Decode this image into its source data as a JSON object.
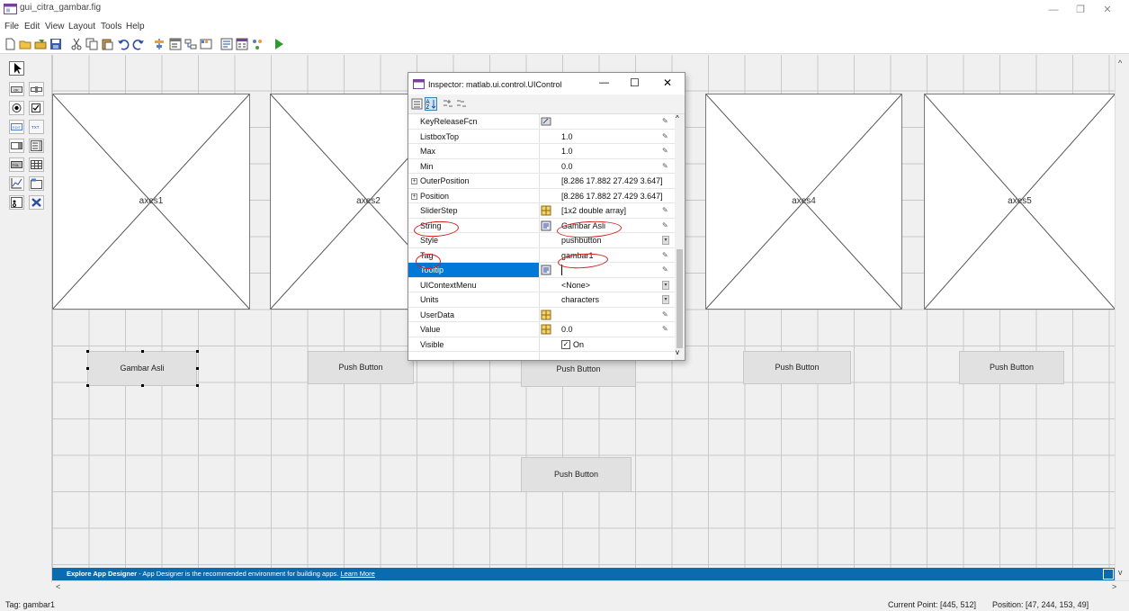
{
  "window": {
    "title": "gui_citra_gambar.fig",
    "minimize": "—",
    "restore": "❐",
    "close": "✕"
  },
  "menu": [
    "File",
    "Edit",
    "View",
    "Layout",
    "Tools",
    "Help"
  ],
  "toolbar_icons": [
    "new-icon",
    "open-icon",
    "open-editor-icon",
    "save-icon",
    "cut-icon",
    "copy-icon",
    "paste-icon",
    "undo-icon",
    "redo-icon",
    "align-icon",
    "menu-editor-icon",
    "tab-order-icon",
    "toolbar-editor-icon",
    "editor-icon",
    "property-inspector-icon",
    "object-browser-icon",
    "run-icon"
  ],
  "palette_icons": [
    "select-tool-icon",
    "pushbutton-tool-icon",
    "slider-tool-icon",
    "radio-tool-icon",
    "checkbox-tool-icon",
    "edit-text-tool-icon",
    "static-text-tool-icon",
    "popup-menu-tool-icon",
    "listbox-tool-icon",
    "toggle-tool-icon",
    "table-tool-icon",
    "axes-tool-icon",
    "panel-tool-icon",
    "button-group-tool-icon",
    "activex-tool-icon"
  ],
  "canvas": {
    "axes": [
      {
        "label": "axes1"
      },
      {
        "label": "axes2"
      },
      {
        "label": "axes3"
      },
      {
        "label": "axes4"
      },
      {
        "label": "axes5"
      }
    ],
    "buttons": [
      {
        "label": "Gambar Asli",
        "selected": true
      },
      {
        "label": "Push Button"
      },
      {
        "label": "Push Button"
      },
      {
        "label": "Push Button"
      },
      {
        "label": "Push Button"
      },
      {
        "label": "Push Button"
      }
    ]
  },
  "infobar": {
    "title": "Explore App Designer",
    "text": " - App Designer is the recommended environment for building apps. ",
    "link": "Learn More"
  },
  "status": {
    "left": "Tag: gambar1",
    "current_point": "Current Point:  [445, 512]",
    "position": "Position: [47, 244, 153, 49]"
  },
  "inspector": {
    "title": "Inspector:  matlab.ui.control.UIControl",
    "properties": [
      {
        "name": "KeyReleaseFcn",
        "value": "",
        "editor": "callback"
      },
      {
        "name": "ListboxTop",
        "value": "1.0"
      },
      {
        "name": "Max",
        "value": "1.0"
      },
      {
        "name": "Min",
        "value": "0.0"
      },
      {
        "name": "OuterPosition",
        "value": "[8.286 17.882 27.429 3.647]",
        "expandable": true
      },
      {
        "name": "Position",
        "value": "[8.286 17.882 27.429 3.647]",
        "expandable": true
      },
      {
        "name": "SliderStep",
        "value": "[1x2  double array]",
        "editor": "array"
      },
      {
        "name": "String",
        "value": "Gambar Asli",
        "editor": "text"
      },
      {
        "name": "Style",
        "value": "pushbutton",
        "dropdown": true
      },
      {
        "name": "Tag",
        "value": "gambar1"
      },
      {
        "name": "Tooltip",
        "value": "",
        "editor": "text",
        "selected": true
      },
      {
        "name": "UIContextMenu",
        "value": "<None>",
        "dropdown": true
      },
      {
        "name": "Units",
        "value": "characters",
        "dropdown": true
      },
      {
        "name": "UserData",
        "value": "",
        "editor": "array"
      },
      {
        "name": "Value",
        "value": "0.0",
        "editor": "array"
      },
      {
        "name": "Visible",
        "value": "On",
        "checkbox": true
      }
    ]
  }
}
